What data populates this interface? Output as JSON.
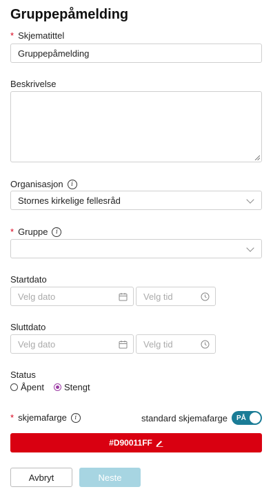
{
  "page": {
    "title": "Gruppepåmelding"
  },
  "form": {
    "schema_title": {
      "label": "Skjematittel",
      "required_mark": "*",
      "value": "Gruppepåmelding"
    },
    "description": {
      "label": "Beskrivelse",
      "value": ""
    },
    "organisation": {
      "label": "Organisasjon",
      "value": "Stornes kirkelige fellesråd"
    },
    "group": {
      "label": "Gruppe",
      "required_mark": "*",
      "value": ""
    },
    "start": {
      "label": "Startdato",
      "date_placeholder": "Velg dato",
      "time_placeholder": "Velg tid"
    },
    "end": {
      "label": "Sluttdato",
      "date_placeholder": "Velg dato",
      "time_placeholder": "Velg tid"
    },
    "status": {
      "label": "Status",
      "options": [
        "Åpent",
        "Stengt"
      ],
      "selected": "Stengt"
    },
    "schema_color": {
      "label": "skjemafarge",
      "required_mark": "*",
      "default_label": "standard skjemafarge",
      "toggle_label": "PÅ",
      "toggle_on": true,
      "value": "#D90011FF",
      "color": "#d90011"
    }
  },
  "buttons": {
    "cancel": "Avbryt",
    "next": "Neste"
  },
  "colors": {
    "accent": "#1a7c96",
    "required": "#d9001b",
    "radio": "#9b3aa3",
    "next_disabled": "#a7d5e2"
  }
}
